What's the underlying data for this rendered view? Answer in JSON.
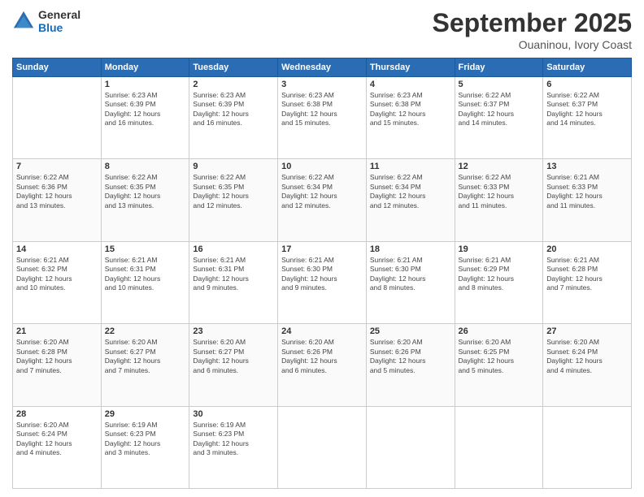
{
  "header": {
    "logo": {
      "general": "General",
      "blue": "Blue"
    },
    "title": "September 2025",
    "subtitle": "Ouaninou, Ivory Coast"
  },
  "days_of_week": [
    "Sunday",
    "Monday",
    "Tuesday",
    "Wednesday",
    "Thursday",
    "Friday",
    "Saturday"
  ],
  "weeks": [
    [
      {
        "day": "",
        "info": ""
      },
      {
        "day": "1",
        "info": "Sunrise: 6:23 AM\nSunset: 6:39 PM\nDaylight: 12 hours\nand 16 minutes."
      },
      {
        "day": "2",
        "info": "Sunrise: 6:23 AM\nSunset: 6:39 PM\nDaylight: 12 hours\nand 16 minutes."
      },
      {
        "day": "3",
        "info": "Sunrise: 6:23 AM\nSunset: 6:38 PM\nDaylight: 12 hours\nand 15 minutes."
      },
      {
        "day": "4",
        "info": "Sunrise: 6:23 AM\nSunset: 6:38 PM\nDaylight: 12 hours\nand 15 minutes."
      },
      {
        "day": "5",
        "info": "Sunrise: 6:22 AM\nSunset: 6:37 PM\nDaylight: 12 hours\nand 14 minutes."
      },
      {
        "day": "6",
        "info": "Sunrise: 6:22 AM\nSunset: 6:37 PM\nDaylight: 12 hours\nand 14 minutes."
      }
    ],
    [
      {
        "day": "7",
        "info": "Sunrise: 6:22 AM\nSunset: 6:36 PM\nDaylight: 12 hours\nand 13 minutes."
      },
      {
        "day": "8",
        "info": "Sunrise: 6:22 AM\nSunset: 6:35 PM\nDaylight: 12 hours\nand 13 minutes."
      },
      {
        "day": "9",
        "info": "Sunrise: 6:22 AM\nSunset: 6:35 PM\nDaylight: 12 hours\nand 12 minutes."
      },
      {
        "day": "10",
        "info": "Sunrise: 6:22 AM\nSunset: 6:34 PM\nDaylight: 12 hours\nand 12 minutes."
      },
      {
        "day": "11",
        "info": "Sunrise: 6:22 AM\nSunset: 6:34 PM\nDaylight: 12 hours\nand 12 minutes."
      },
      {
        "day": "12",
        "info": "Sunrise: 6:22 AM\nSunset: 6:33 PM\nDaylight: 12 hours\nand 11 minutes."
      },
      {
        "day": "13",
        "info": "Sunrise: 6:21 AM\nSunset: 6:33 PM\nDaylight: 12 hours\nand 11 minutes."
      }
    ],
    [
      {
        "day": "14",
        "info": "Sunrise: 6:21 AM\nSunset: 6:32 PM\nDaylight: 12 hours\nand 10 minutes."
      },
      {
        "day": "15",
        "info": "Sunrise: 6:21 AM\nSunset: 6:31 PM\nDaylight: 12 hours\nand 10 minutes."
      },
      {
        "day": "16",
        "info": "Sunrise: 6:21 AM\nSunset: 6:31 PM\nDaylight: 12 hours\nand 9 minutes."
      },
      {
        "day": "17",
        "info": "Sunrise: 6:21 AM\nSunset: 6:30 PM\nDaylight: 12 hours\nand 9 minutes."
      },
      {
        "day": "18",
        "info": "Sunrise: 6:21 AM\nSunset: 6:30 PM\nDaylight: 12 hours\nand 8 minutes."
      },
      {
        "day": "19",
        "info": "Sunrise: 6:21 AM\nSunset: 6:29 PM\nDaylight: 12 hours\nand 8 minutes."
      },
      {
        "day": "20",
        "info": "Sunrise: 6:21 AM\nSunset: 6:28 PM\nDaylight: 12 hours\nand 7 minutes."
      }
    ],
    [
      {
        "day": "21",
        "info": "Sunrise: 6:20 AM\nSunset: 6:28 PM\nDaylight: 12 hours\nand 7 minutes."
      },
      {
        "day": "22",
        "info": "Sunrise: 6:20 AM\nSunset: 6:27 PM\nDaylight: 12 hours\nand 7 minutes."
      },
      {
        "day": "23",
        "info": "Sunrise: 6:20 AM\nSunset: 6:27 PM\nDaylight: 12 hours\nand 6 minutes."
      },
      {
        "day": "24",
        "info": "Sunrise: 6:20 AM\nSunset: 6:26 PM\nDaylight: 12 hours\nand 6 minutes."
      },
      {
        "day": "25",
        "info": "Sunrise: 6:20 AM\nSunset: 6:26 PM\nDaylight: 12 hours\nand 5 minutes."
      },
      {
        "day": "26",
        "info": "Sunrise: 6:20 AM\nSunset: 6:25 PM\nDaylight: 12 hours\nand 5 minutes."
      },
      {
        "day": "27",
        "info": "Sunrise: 6:20 AM\nSunset: 6:24 PM\nDaylight: 12 hours\nand 4 minutes."
      }
    ],
    [
      {
        "day": "28",
        "info": "Sunrise: 6:20 AM\nSunset: 6:24 PM\nDaylight: 12 hours\nand 4 minutes."
      },
      {
        "day": "29",
        "info": "Sunrise: 6:19 AM\nSunset: 6:23 PM\nDaylight: 12 hours\nand 3 minutes."
      },
      {
        "day": "30",
        "info": "Sunrise: 6:19 AM\nSunset: 6:23 PM\nDaylight: 12 hours\nand 3 minutes."
      },
      {
        "day": "",
        "info": ""
      },
      {
        "day": "",
        "info": ""
      },
      {
        "day": "",
        "info": ""
      },
      {
        "day": "",
        "info": ""
      }
    ]
  ]
}
